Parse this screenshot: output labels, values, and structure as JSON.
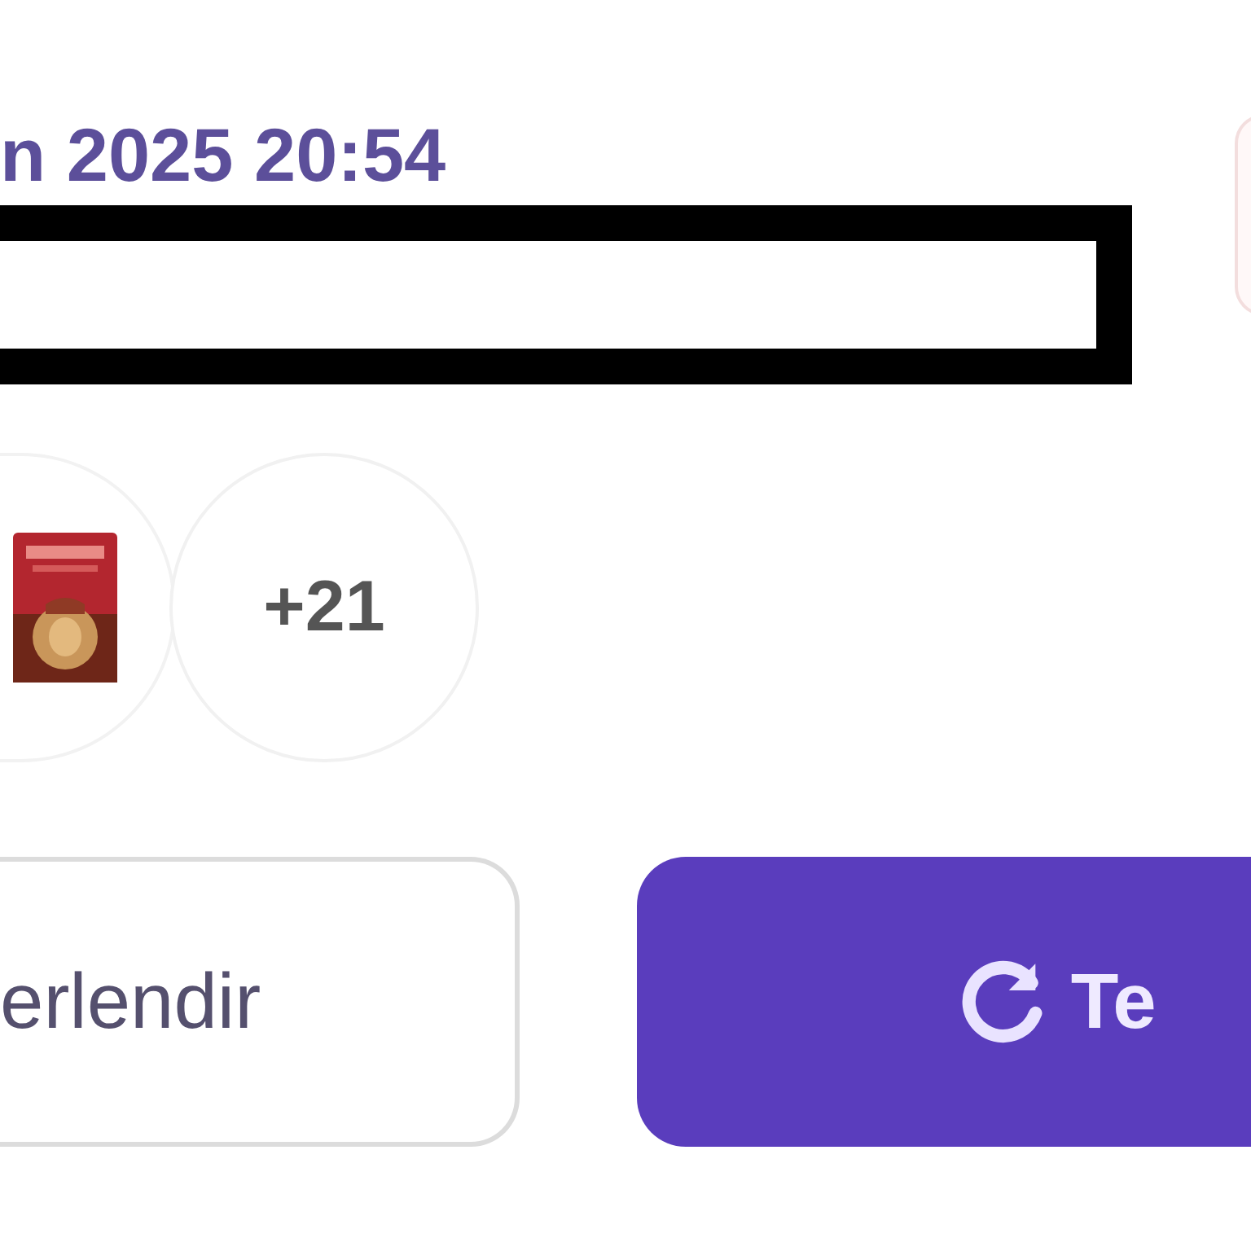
{
  "order": {
    "date": "n 2025 20:54",
    "more_count": "+21"
  },
  "buttons": [
    {
      "label": "erlendir",
      "kind": "outline"
    },
    {
      "label": "Te",
      "kind": "primary"
    }
  ]
}
